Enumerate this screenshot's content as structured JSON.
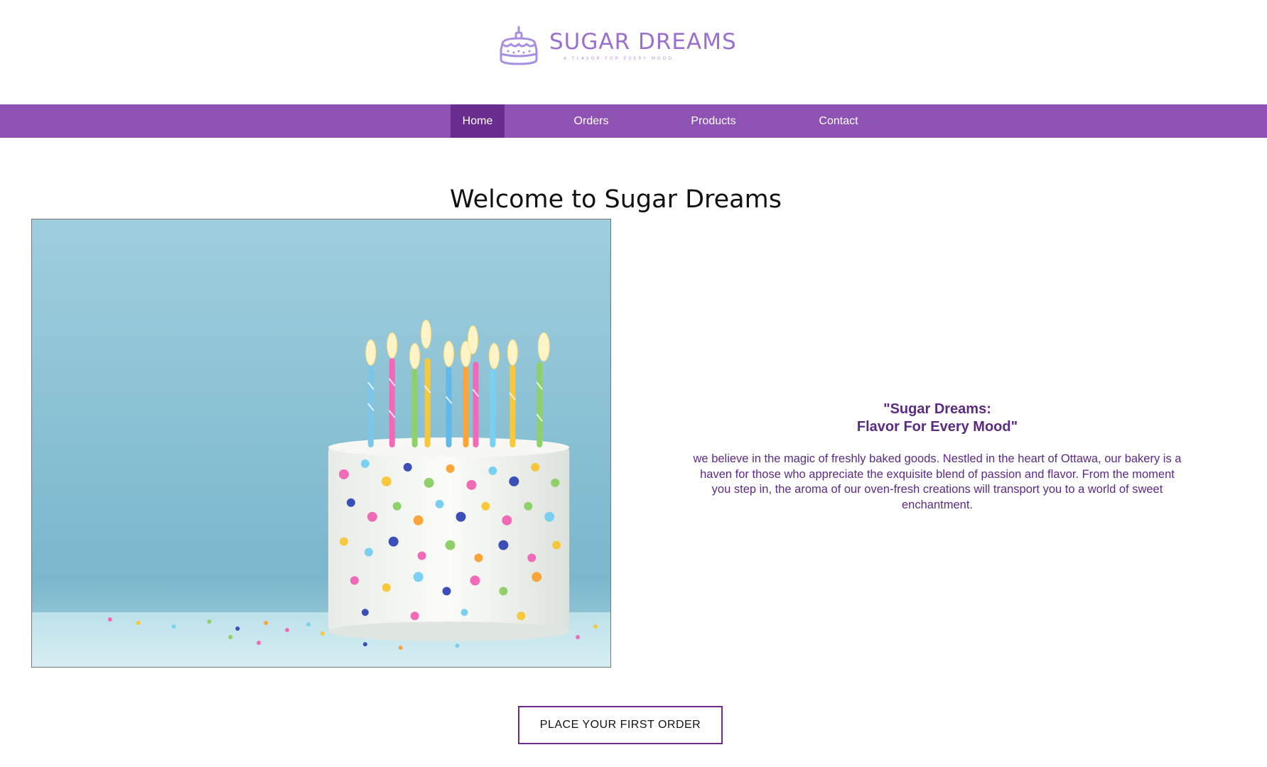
{
  "brand": {
    "name": "SUGAR DREAMS",
    "tagline": "A FLAVOR FOR EVERY MOOD",
    "logo_icon": "cake-icon",
    "color": "#9b6fd0"
  },
  "nav": {
    "background": "#8e52b3",
    "active_background": "#6a2d8f",
    "items": [
      {
        "label": "Home",
        "active": true
      },
      {
        "label": "Orders",
        "active": false
      },
      {
        "label": "Products",
        "active": false
      },
      {
        "label": "Contact",
        "active": false
      }
    ]
  },
  "main": {
    "title": "Welcome to Sugar Dreams",
    "hero_image": "birthday-cake-with-candles-and-sprinkles",
    "slogan_line1": "\"Sugar Dreams:",
    "slogan_line2": "Flavor For Every Mood\"",
    "description": "we believe in the magic of freshly baked goods. Nestled in the heart of Ottawa, our bakery is a haven for those who appreciate the exquisite blend of passion and flavor. From the moment you step in, the aroma of our oven-fresh creations will transport you to a world of sweet enchantment.",
    "cta_label": "PLACE YOUR FIRST ORDER",
    "accent_color": "#5b2a83"
  }
}
